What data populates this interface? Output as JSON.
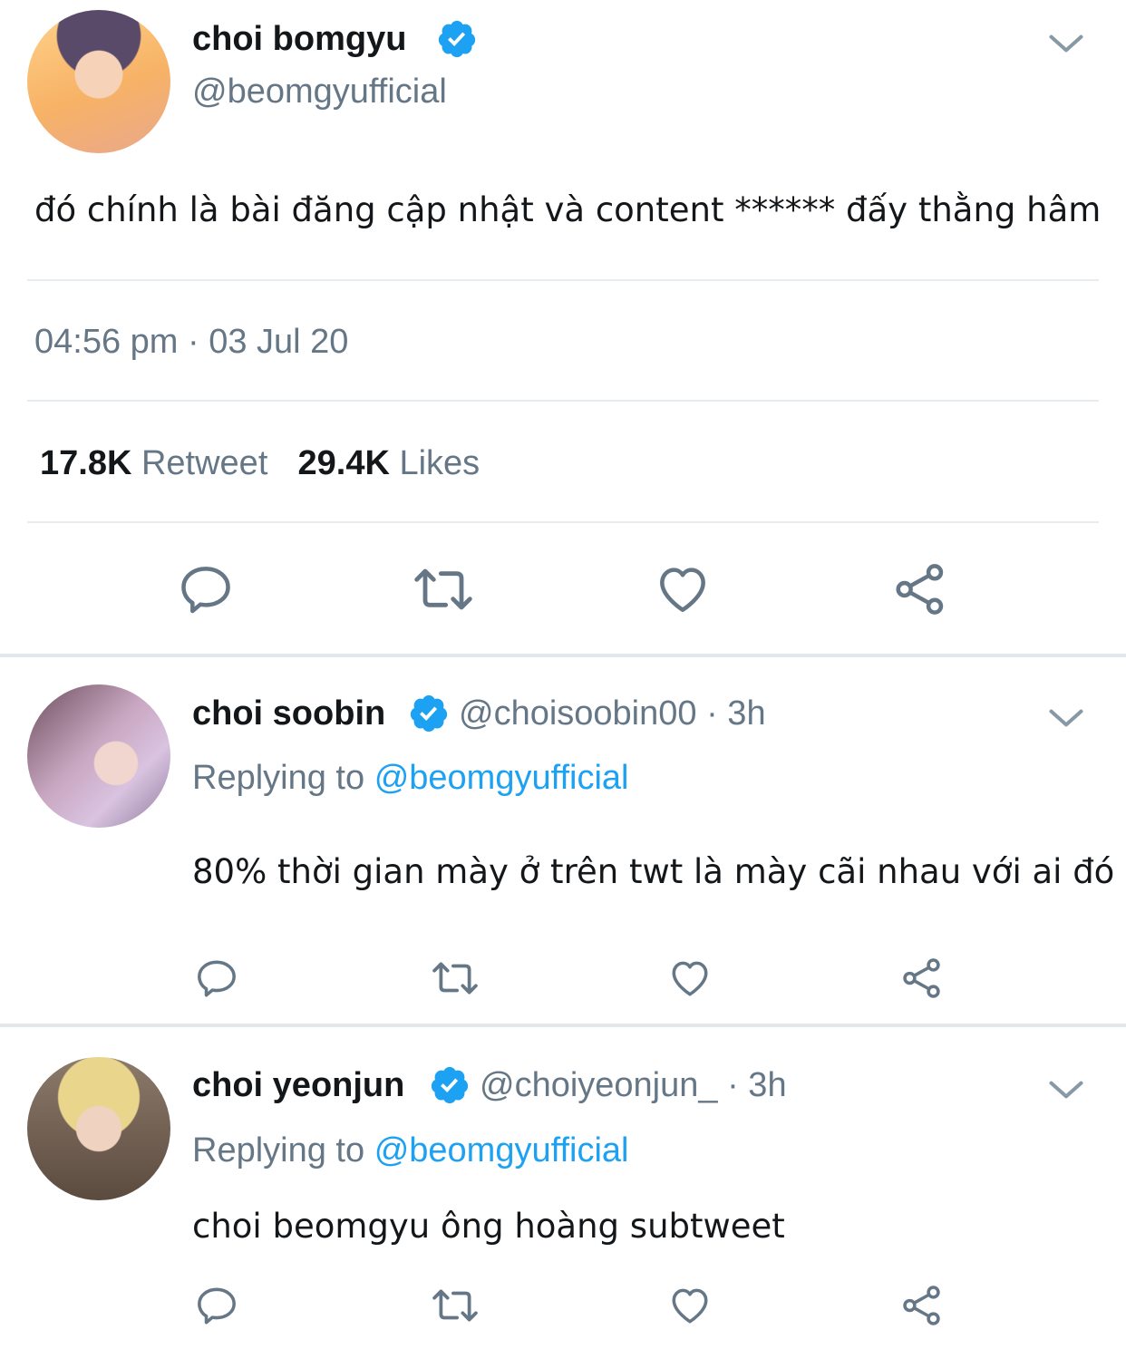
{
  "main_tweet": {
    "display_name": "choi bomgyu",
    "handle": "@beomgyufficial",
    "text": "đó chính là bài đăng cập nhật và content ****** đấy thằng hâm",
    "timestamp": "04:56 pm · 03 Jul 20",
    "retweet_count": "17.8K",
    "retweet_label": "Retweet",
    "like_count": "29.4K",
    "like_label": "Likes"
  },
  "replies": [
    {
      "display_name": "choi soobin",
      "handle": "@choisoobin00",
      "time": "· 3h",
      "replying_prefix": "Replying to",
      "replying_to": "@beomgyufficial",
      "text": "80% thời gian mày ở trên twt là mày cãi nhau với ai đó"
    },
    {
      "display_name": "choi yeonjun",
      "handle": "@choiyeonjun_",
      "time": "· 3h",
      "replying_prefix": "Replying to",
      "replying_to": "@beomgyufficial",
      "text": "choi beomgyu ông hoàng subtweet"
    }
  ],
  "colors": {
    "text_primary": "#14171a",
    "text_secondary": "#657786",
    "accent_blue": "#1da1f2",
    "divider": "#e6ecf0"
  },
  "icons": [
    "verified-badge-icon",
    "chevron-down-icon",
    "reply-icon",
    "retweet-icon",
    "like-icon",
    "share-icon"
  ]
}
